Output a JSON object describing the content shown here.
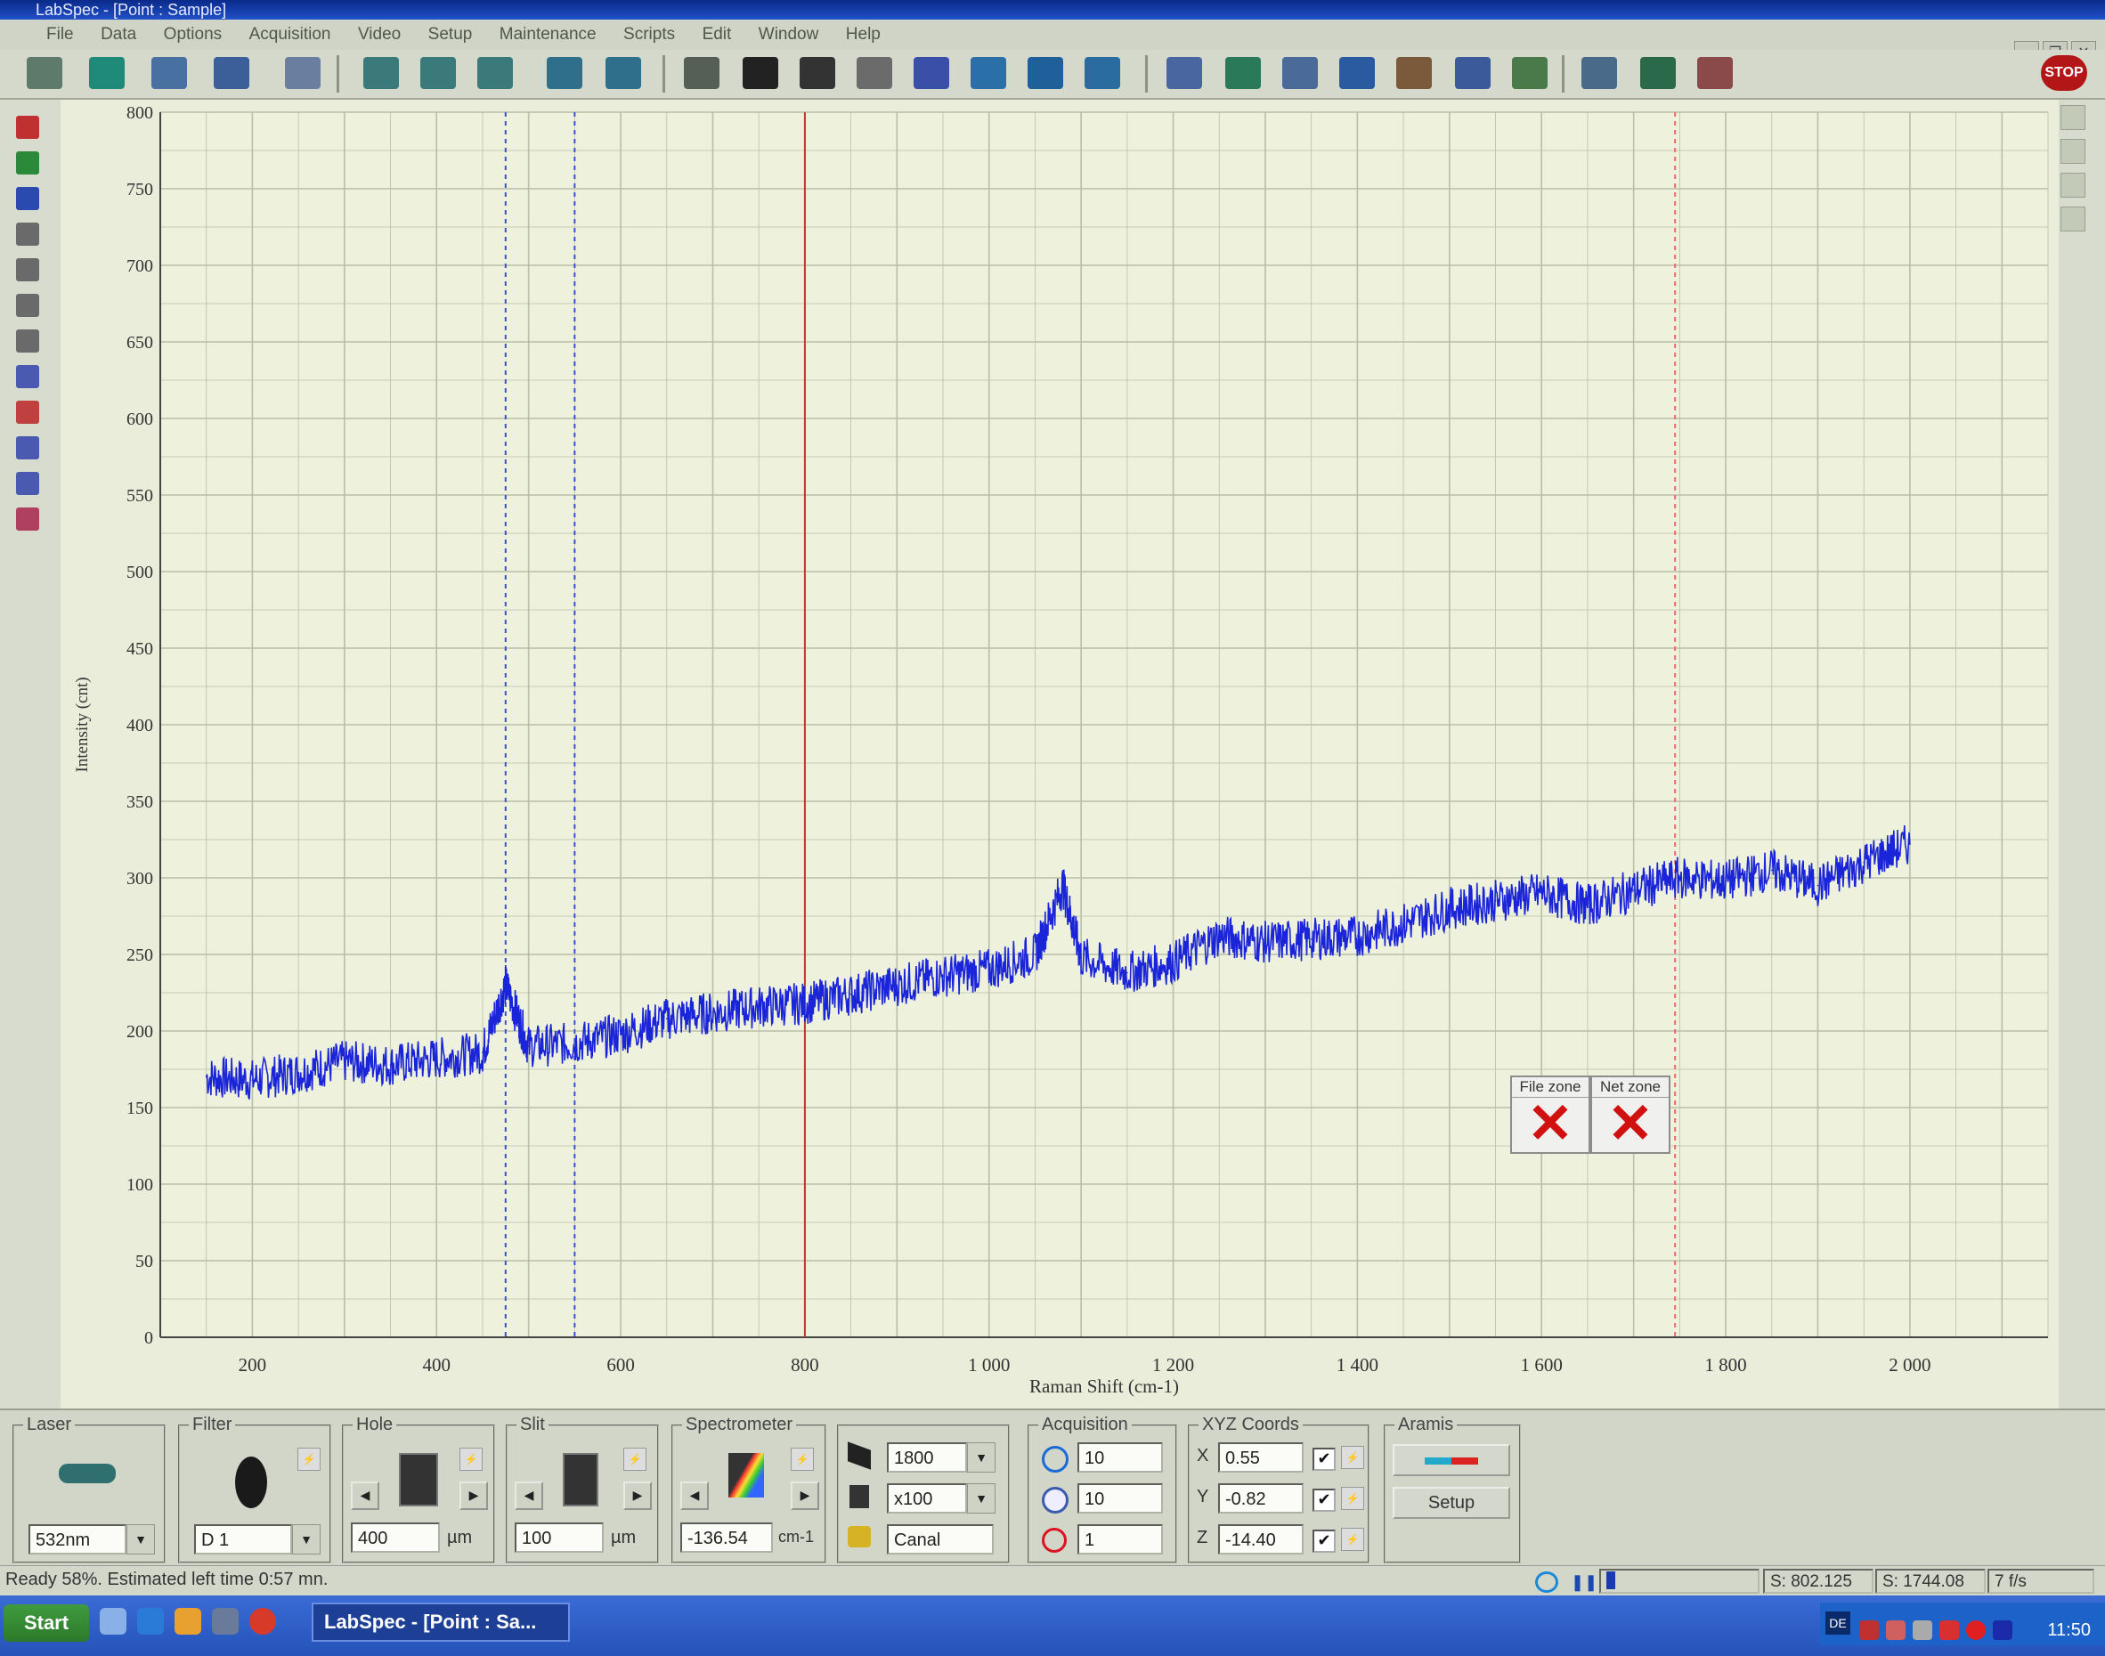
{
  "window": {
    "title": "LabSpec - [Point : Sample]",
    "controls": [
      "_",
      "❐",
      "✕"
    ]
  },
  "menu": [
    "File",
    "Data",
    "Options",
    "Acquisition",
    "Video",
    "Setup",
    "Maintenance",
    "Scripts",
    "Edit",
    "Window",
    "Help"
  ],
  "toolbar": {
    "stop_label": "STOP"
  },
  "chart_data": {
    "type": "line",
    "xlabel": "Raman Shift (cm-1)",
    "ylabel": "Intensity (cnt)",
    "xlim": [
      100,
      2150
    ],
    "ylim": [
      0,
      800
    ],
    "xticks": [
      "200",
      "400",
      "600",
      "800",
      "1 000",
      "1 200",
      "1 400",
      "1 600",
      "1 800",
      "2 000"
    ],
    "yticks": [
      "0",
      "50",
      "100",
      "150",
      "200",
      "250",
      "300",
      "350",
      "400",
      "450",
      "500",
      "550",
      "600",
      "650",
      "700",
      "750",
      "800"
    ],
    "markers": [
      {
        "x": 475,
        "color": "#3c4fd0",
        "style": "dashed"
      },
      {
        "x": 550,
        "color": "#3c4fd0",
        "style": "dashed"
      },
      {
        "x": 800,
        "color": "#c0392b",
        "style": "solid"
      },
      {
        "x": 1745,
        "color": "#e07070",
        "style": "dashed"
      }
    ],
    "series": [
      {
        "color": "#1a24d8",
        "x": [
          150,
          200,
          250,
          300,
          350,
          400,
          450,
          475,
          500,
          550,
          600,
          650,
          700,
          750,
          800,
          850,
          900,
          950,
          1000,
          1050,
          1080,
          1100,
          1150,
          1200,
          1250,
          1300,
          1350,
          1400,
          1450,
          1500,
          1550,
          1600,
          1650,
          1700,
          1750,
          1800,
          1850,
          1900,
          1950,
          2000
        ],
        "y": [
          170,
          168,
          173,
          180,
          178,
          182,
          186,
          230,
          190,
          192,
          198,
          208,
          212,
          216,
          218,
          224,
          230,
          236,
          240,
          250,
          295,
          248,
          238,
          245,
          262,
          258,
          260,
          262,
          270,
          280,
          285,
          290,
          282,
          292,
          300,
          298,
          305,
          295,
          310,
          322
        ]
      }
    ]
  },
  "zones": {
    "file_zone": "File zone",
    "net_zone": "Net zone"
  },
  "panel": {
    "laser": {
      "title": "Laser",
      "value": "532nm"
    },
    "filter": {
      "title": "Filter",
      "value": "D 1"
    },
    "hole": {
      "title": "Hole",
      "value": "400",
      "unit": "µm"
    },
    "slit": {
      "title": "Slit",
      "value": "100",
      "unit": "µm"
    },
    "spectrometer": {
      "title": "Spectrometer",
      "value": "-136.54",
      "unit": "cm-1"
    },
    "grating": {
      "grating": "1800",
      "objective": "x100",
      "detector": "Canal"
    },
    "acquisition": {
      "title": "Acquisition",
      "time": "10",
      "accum": "10",
      "count": "1"
    },
    "xyz": {
      "title": "XYZ Coords",
      "x_label": "X",
      "x": "0.55",
      "y_label": "Y",
      "y": "-0.82",
      "z_label": "Z",
      "z": "-14.40"
    },
    "aramis": {
      "title": "Aramis",
      "setup": "Setup"
    }
  },
  "status": {
    "message": "Ready 58%. Estimated left time 0:57 mn.",
    "s1": "S: 802.125",
    "s2": "S: 1744.08",
    "fps": "7 f/s"
  },
  "taskbar": {
    "start": "Start",
    "task": "LabSpec - [Point : Sa...",
    "clock": "11:50",
    "lang": "DE"
  }
}
